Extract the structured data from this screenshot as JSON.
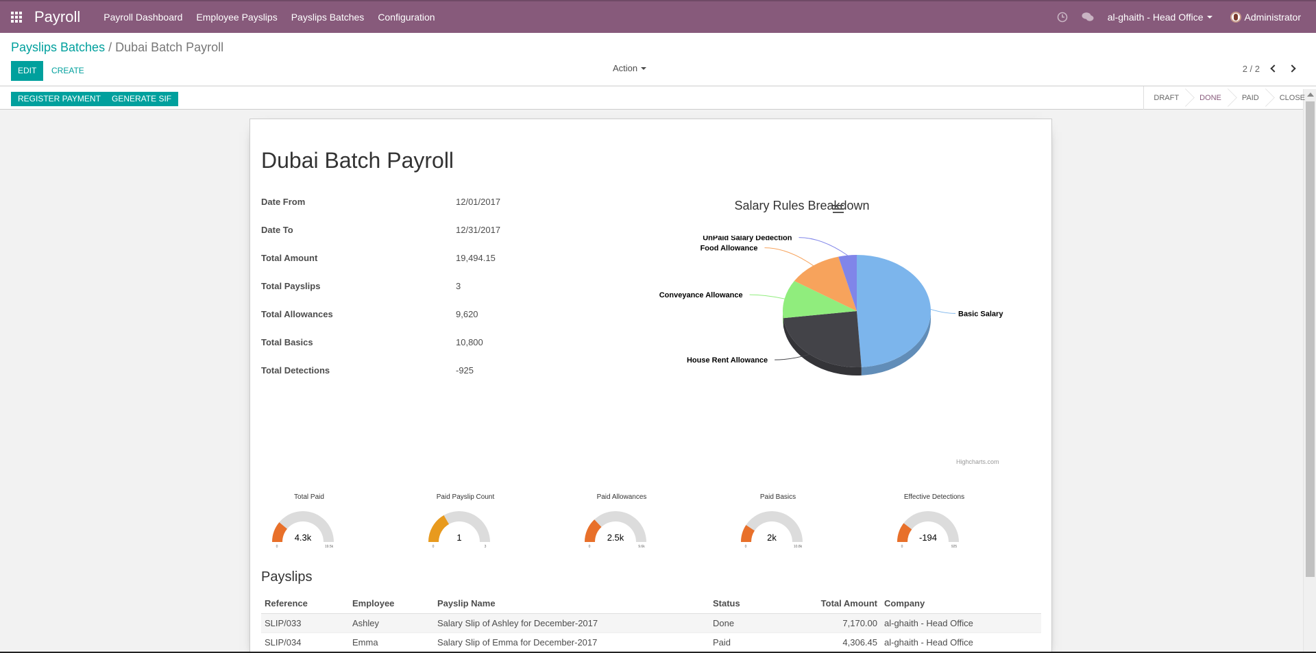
{
  "app": {
    "brand": "Payroll",
    "nav": [
      "Payroll Dashboard",
      "Employee Payslips",
      "Payslips Batches",
      "Configuration"
    ],
    "company": "al-ghaith - Head Office",
    "user": "Administrator"
  },
  "control": {
    "breadcrumb_parent": "Payslips Batches",
    "breadcrumb_sep": "/",
    "breadcrumb_current": "Dubai Batch Payroll",
    "edit_label": "EDIT",
    "create_label": "CREATE",
    "action_label": "Action",
    "pager": "2 / 2"
  },
  "statusbar": {
    "register_payment": "REGISTER PAYMENT",
    "generate_sif": "GENERATE SIF",
    "stages": [
      "DRAFT",
      "DONE",
      "PAID",
      "CLOSE"
    ],
    "active_stage": "DONE"
  },
  "record": {
    "title": "Dubai Batch Payroll",
    "fields": [
      {
        "label": "Date From",
        "value": "12/01/2017"
      },
      {
        "label": "Date To",
        "value": "12/31/2017"
      },
      {
        "label": "Total Amount",
        "value": "19,494.15"
      },
      {
        "label": "Total Payslips",
        "value": "3"
      },
      {
        "label": "Total Allowances",
        "value": "9,620"
      },
      {
        "label": "Total Basics",
        "value": "10,800"
      },
      {
        "label": "Total Detections",
        "value": "-925"
      }
    ]
  },
  "chart_data": [
    {
      "type": "pie",
      "title": "Salary Rules Breakdown",
      "credit": "Highcharts.com",
      "categories": [
        "Basic Salary",
        "House Rent Allowance",
        "Conveyance Allowance",
        "Food Allowance",
        "UnPaid Salary Dedection"
      ],
      "values": [
        49,
        24,
        11,
        12,
        4
      ],
      "colors": [
        "#7cb5ec",
        "#434348",
        "#90ed7d",
        "#f7a35c",
        "#8085e9"
      ]
    },
    {
      "type": "gauge",
      "gauges": [
        {
          "title": "Total Paid",
          "display": "4.3k",
          "value": 4306,
          "min_label": "0",
          "max_label": "19.5k",
          "max": 19494,
          "color": "#e8702a"
        },
        {
          "title": "Paid Payslip Count",
          "display": "1",
          "value": 1,
          "min_label": "0",
          "max_label": "3",
          "max": 3,
          "color": "#e89a1e"
        },
        {
          "title": "Paid Allowances",
          "display": "2.5k",
          "value": 2500,
          "min_label": "0",
          "max_label": "9.6k",
          "max": 9620,
          "color": "#e8702a"
        },
        {
          "title": "Paid Basics",
          "display": "2k",
          "value": 2000,
          "min_label": "0",
          "max_label": "10.8k",
          "max": 10800,
          "color": "#e8702a"
        },
        {
          "title": "Effective Detections",
          "display": "-194",
          "value": 194,
          "min_label": "0",
          "max_label": "925",
          "max": 925,
          "color": "#e8702a"
        }
      ]
    }
  ],
  "payslips": {
    "title": "Payslips",
    "columns": [
      "Reference",
      "Employee",
      "Payslip Name",
      "Status",
      "Total Amount",
      "Company"
    ],
    "rows": [
      [
        "SLIP/033",
        "Ashley",
        "Salary Slip of Ashley for December-2017",
        "Done",
        "7,170.00",
        "al-ghaith - Head Office"
      ],
      [
        "SLIP/034",
        "Emma",
        "Salary Slip of Emma for December-2017",
        "Paid",
        "4,306.45",
        "al-ghaith - Head Office"
      ]
    ]
  }
}
